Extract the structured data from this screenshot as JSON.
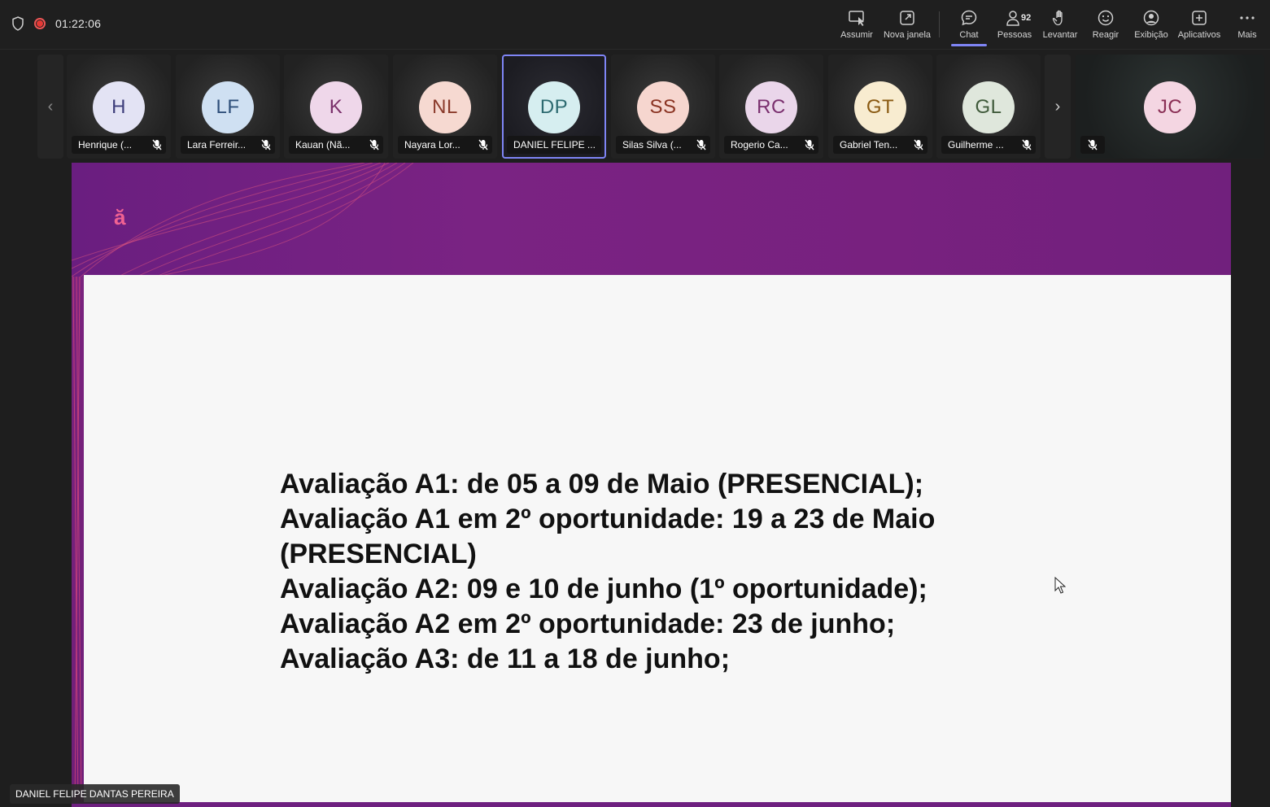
{
  "topbar": {
    "timer": "01:22:06",
    "buttons": {
      "assumir": "Assumir",
      "nova_janela": "Nova janela",
      "chat": "Chat",
      "pessoas": "Pessoas",
      "pessoas_count": "92",
      "levantar": "Levantar",
      "reagir": "Reagir",
      "exibicao": "Exibição",
      "aplicativos": "Aplicativos",
      "mais": "Mais"
    },
    "active_tab": "Chat",
    "accent_color": "#7f85f5",
    "record_color": "#e53935"
  },
  "participants": [
    {
      "initials": "H",
      "name": "Henrique (...",
      "avatar_bg": "#e3e3f4",
      "avatar_fg": "#3d3d7a",
      "muted": true
    },
    {
      "initials": "LF",
      "name": "Lara Ferreir...",
      "avatar_bg": "#cfe0f2",
      "avatar_fg": "#2e4f7a",
      "muted": true
    },
    {
      "initials": "K",
      "name": "Kauan (Nã...",
      "avatar_bg": "#efd7ea",
      "avatar_fg": "#7a2f6a",
      "muted": true
    },
    {
      "initials": "NL",
      "name": "Nayara Lor...",
      "avatar_bg": "#f6d9d1",
      "avatar_fg": "#8a3a2b",
      "muted": true
    },
    {
      "initials": "DP",
      "name": "DANIEL FELIPE ...",
      "avatar_bg": "#d6eef0",
      "avatar_fg": "#2c6a70",
      "muted": false,
      "active": true
    },
    {
      "initials": "SS",
      "name": "Silas Silva (...",
      "avatar_bg": "#f6d6cf",
      "avatar_fg": "#8a3322",
      "muted": true
    },
    {
      "initials": "RC",
      "name": "Rogerio Ca...",
      "avatar_bg": "#ead6ea",
      "avatar_fg": "#7a2f6e",
      "muted": true
    },
    {
      "initials": "GT",
      "name": "Gabriel Ten...",
      "avatar_bg": "#f8ecd0",
      "avatar_fg": "#8a5a12",
      "muted": true
    },
    {
      "initials": "GL",
      "name": "Guilherme ...",
      "avatar_bg": "#dfe7dc",
      "avatar_fg": "#3f5a3a",
      "muted": true
    }
  ],
  "featured_participant": {
    "initials": "JC",
    "avatar_bg": "#f4d6e2",
    "avatar_fg": "#8a2f55",
    "muted": true
  },
  "slide": {
    "logo_mark": "ă",
    "lines": [
      "Avaliação A1: de 05 a 09 de Maio (PRESENCIAL);",
      "Avaliação A1 em 2º oportunidade: 19 a 23 de Maio",
      "(PRESENCIAL)",
      "Avaliação A2: 09 e 10 de junho (1º oportunidade);",
      "Avaliação A2 em 2º oportunidade: 23 de junho;",
      "Avaliação A3: de 11 a 18 de junho;"
    ],
    "header_color": "#7a2383",
    "logo_color": "#f06292"
  },
  "presenter_name": "DANIEL FELIPE DANTAS PEREIRA"
}
